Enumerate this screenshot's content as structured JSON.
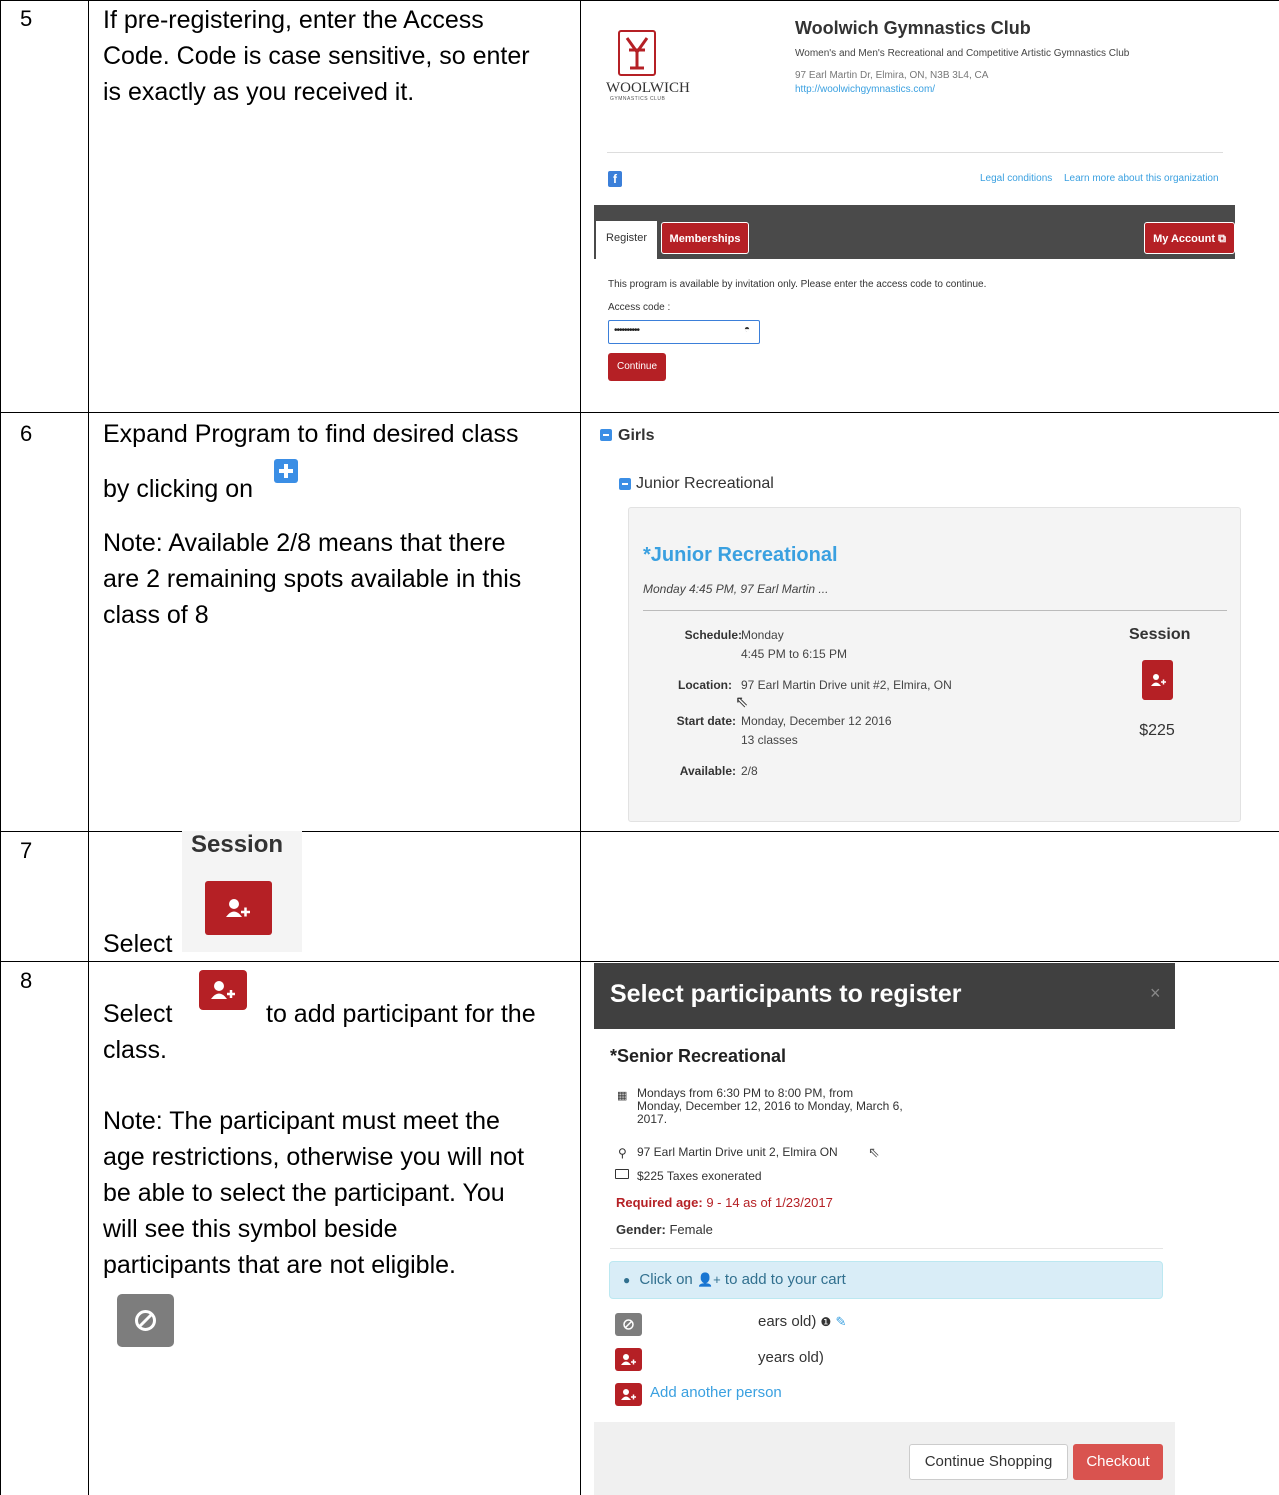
{
  "rows": [
    {
      "num": "5",
      "lines": [
        "If pre-registering, enter the Access",
        "Code.  Code is case sensitive, so enter",
        "is exactly as you received it."
      ]
    },
    {
      "num": "6",
      "lines": [
        "Expand Program to find desired class",
        "by clicking on"
      ],
      "note": [
        "Note: Available 2/8 means that there",
        "are 2 remaining spots available in this",
        "class of 8"
      ]
    },
    {
      "num": "7",
      "select": "Select"
    },
    {
      "num": "8",
      "select": "Select",
      "after": "to add participant for the",
      "after2": "class.",
      "note": [
        "Note:  The participant must meet the",
        "age restrictions, otherwise you will not",
        "be able to select the participant.  You",
        "will see this symbol beside",
        "participants that are not eligible."
      ]
    }
  ],
  "org": {
    "name": "Woolwich Gymnastics Club",
    "desc": "Women's and Men's Recreational and Competitive Artistic Gymnastics Club",
    "address": "97 Earl Martin Dr, Elmira, ON, N3B 3L4, CA",
    "url": "http://woolwichgymnastics.com/",
    "logo_text": "WOOLWICH",
    "logo_sub": "GYMNASTICS CLUB",
    "legal": "Legal conditions",
    "learn": "Learn more about this organization",
    "tab_register": "Register",
    "tab_memberships": "Memberships",
    "my_account": "My Account",
    "invite_msg": "This program is available by invitation only. Please enter the access code to continue.",
    "access_label": "Access code :",
    "access_value": "••••••••••",
    "continue": "Continue"
  },
  "program": {
    "group": "Girls",
    "sub": "Junior Recreational",
    "title": "*Junior Recreational",
    "summary": "Monday 4:45 PM, 97 Earl Martin ...",
    "schedule_label": "Schedule:",
    "schedule_1": "Monday",
    "schedule_2": "4:45 PM to 6:15 PM",
    "location_label": "Location:",
    "location": "97 Earl Martin Drive unit #2, Elmira, ON",
    "start_label": "Start date:",
    "start_1": "Monday, December 12 2016",
    "start_2": "13 classes",
    "avail_label": "Available:",
    "avail": "2/8",
    "session": "Session",
    "price": "$225"
  },
  "step7": {
    "session": "Session"
  },
  "modal": {
    "title": "Select participants to register",
    "close": "×",
    "course": "*Senior Recreational",
    "schedule": [
      "Mondays from 6:30 PM to 8:00 PM, from",
      "Monday, December 12, 2016 to Monday, March 6,",
      "2017."
    ],
    "location": "97 Earl Martin Drive unit 2, Elmira ON",
    "price": "$225 Taxes exonerated",
    "req_label": "Required age:",
    "req_value": "9 - 14 as of 1/23/2017",
    "gender_label": "Gender:",
    "gender_value": "Female",
    "info_pre": "Click on",
    "info_post": "to add to your cart",
    "p1": "ears old)",
    "p2": "years old)",
    "add_person": "Add another person",
    "continue_shopping": "Continue Shopping",
    "checkout": "Checkout"
  },
  "colors": {
    "red": "#b52025",
    "blue_link": "#3aa0e0",
    "dark_bar": "#4a4a4a",
    "modal_header": "#404040"
  }
}
